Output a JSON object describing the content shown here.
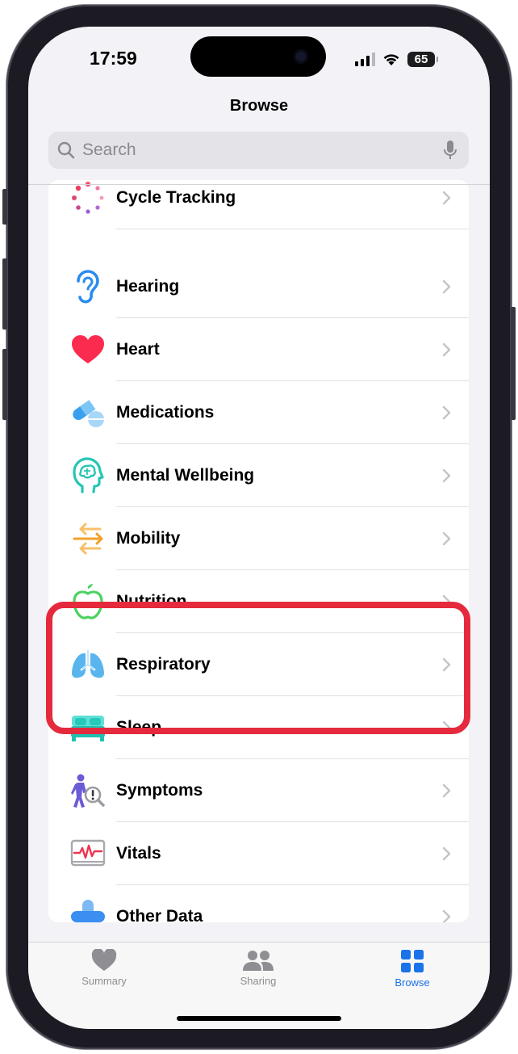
{
  "status_bar": {
    "time": "17:59",
    "battery": "65"
  },
  "nav": {
    "title": "Browse"
  },
  "search": {
    "placeholder": "Search"
  },
  "categories": [
    {
      "label": "Cycle Tracking",
      "icon": "cycle-tracking-icon"
    },
    {
      "label": "Hearing",
      "icon": "ear-icon"
    },
    {
      "label": "Heart",
      "icon": "heart-icon"
    },
    {
      "label": "Medications",
      "icon": "pills-icon"
    },
    {
      "label": "Mental Wellbeing",
      "icon": "head-brain-icon"
    },
    {
      "label": "Mobility",
      "icon": "arrows-icon"
    },
    {
      "label": "Nutrition",
      "icon": "apple-icon"
    },
    {
      "label": "Respiratory",
      "icon": "lungs-icon"
    },
    {
      "label": "Sleep",
      "icon": "bed-icon"
    },
    {
      "label": "Symptoms",
      "icon": "person-magnifier-icon"
    },
    {
      "label": "Vitals",
      "icon": "ekg-chart-icon"
    },
    {
      "label": "Other Data",
      "icon": "plus-cross-icon"
    }
  ],
  "highlight": {
    "color": "#e52a3d",
    "items": [
      "Respiratory",
      "Sleep"
    ]
  },
  "tabs": [
    {
      "label": "Summary",
      "icon": "heart-icon"
    },
    {
      "label": "Sharing",
      "icon": "people-icon"
    },
    {
      "label": "Browse",
      "icon": "grid-icon",
      "active": true
    }
  ],
  "colors": {
    "accent": "#1a73e8",
    "inactive": "#8e8e93"
  }
}
